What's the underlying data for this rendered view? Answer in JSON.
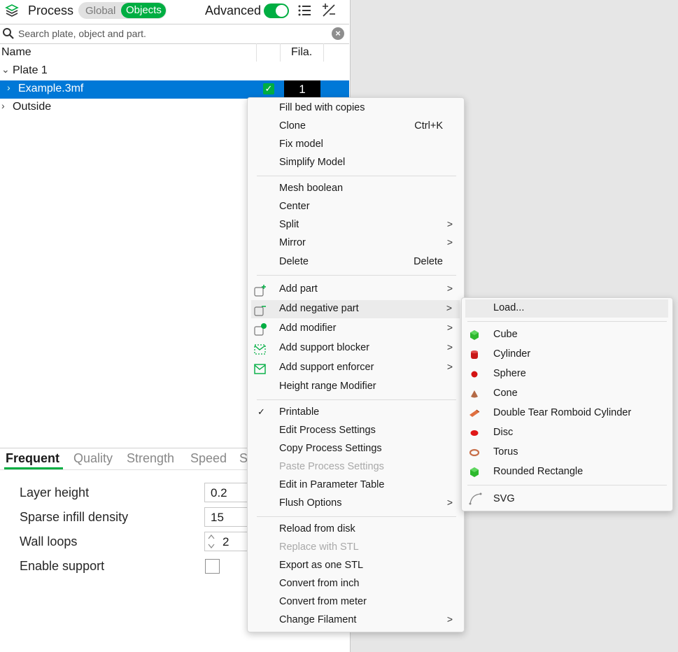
{
  "header": {
    "title": "Process",
    "toggle_global": "Global",
    "toggle_objects": "Objects",
    "advanced_label": "Advanced",
    "advanced_on": true
  },
  "search": {
    "placeholder": "Search plate, object and part."
  },
  "columns": {
    "name": "Name",
    "filament": "Fila."
  },
  "tree": {
    "plate": "Plate 1",
    "object": "Example.3mf",
    "object_filament": "1",
    "outside": "Outside"
  },
  "tabs": [
    "Frequent",
    "Quality",
    "Strength",
    "Speed",
    "S"
  ],
  "settings": [
    {
      "label": "Layer height",
      "value": "0.2"
    },
    {
      "label": "Sparse infill density",
      "value": "15"
    },
    {
      "label": "Wall loops",
      "value": "2"
    },
    {
      "label": "Enable support",
      "value": ""
    }
  ],
  "context_menu": {
    "items": [
      {
        "label": "Fill bed with copies"
      },
      {
        "label": "Clone",
        "shortcut": "Ctrl+K"
      },
      {
        "label": "Fix model"
      },
      {
        "label": "Simplify Model"
      },
      {
        "label": "Mesh boolean"
      },
      {
        "label": "Center"
      },
      {
        "label": "Split",
        "submenu": ">"
      },
      {
        "label": "Mirror",
        "submenu": ">"
      },
      {
        "label": "Delete",
        "shortcut": "Delete"
      },
      {
        "label": "Add part",
        "icon": "add-part-icon",
        "submenu": ">"
      },
      {
        "label": "Add negative part",
        "icon": "add-negative-part-icon",
        "submenu": ">"
      },
      {
        "label": "Add modifier",
        "icon": "add-modifier-icon",
        "submenu": ">"
      },
      {
        "label": "Add support blocker",
        "icon": "support-blocker-icon",
        "submenu": ">"
      },
      {
        "label": "Add support enforcer",
        "icon": "support-enforcer-icon",
        "submenu": ">"
      },
      {
        "label": "Height range Modifier"
      },
      {
        "label": "Printable",
        "checked": "✓"
      },
      {
        "label": "Edit Process Settings"
      },
      {
        "label": "Copy Process Settings"
      },
      {
        "label": "Paste Process Settings",
        "disabled": true
      },
      {
        "label": "Edit in Parameter Table"
      },
      {
        "label": "Flush Options",
        "submenu": ">"
      },
      {
        "label": "Reload from disk"
      },
      {
        "label": "Replace with STL",
        "disabled": true
      },
      {
        "label": "Export as one STL"
      },
      {
        "label": "Convert from inch"
      },
      {
        "label": "Convert from meter"
      },
      {
        "label": "Change Filament",
        "submenu": ">"
      }
    ]
  },
  "submenu": {
    "items": [
      {
        "label": "Load..."
      },
      {
        "label": "Cube",
        "icon": "cube-icon",
        "color": "#2db82d"
      },
      {
        "label": "Cylinder",
        "icon": "cylinder-icon",
        "color": "#c81818"
      },
      {
        "label": "Sphere",
        "icon": "sphere-icon",
        "color": "#d41414"
      },
      {
        "label": "Cone",
        "icon": "cone-icon",
        "color": "#b46a46"
      },
      {
        "label": "Double Tear Romboid Cylinder",
        "icon": "double-tear-icon",
        "color": "#e07040"
      },
      {
        "label": "Disc",
        "icon": "disc-icon",
        "color": "#e01818"
      },
      {
        "label": "Torus",
        "icon": "torus-icon",
        "color": "#c8704a"
      },
      {
        "label": "Rounded Rectangle",
        "icon": "rounded-rectangle-icon",
        "color": "#2db82d"
      },
      {
        "label": "SVG",
        "icon": "svg-icon",
        "color": "#888888"
      }
    ]
  }
}
